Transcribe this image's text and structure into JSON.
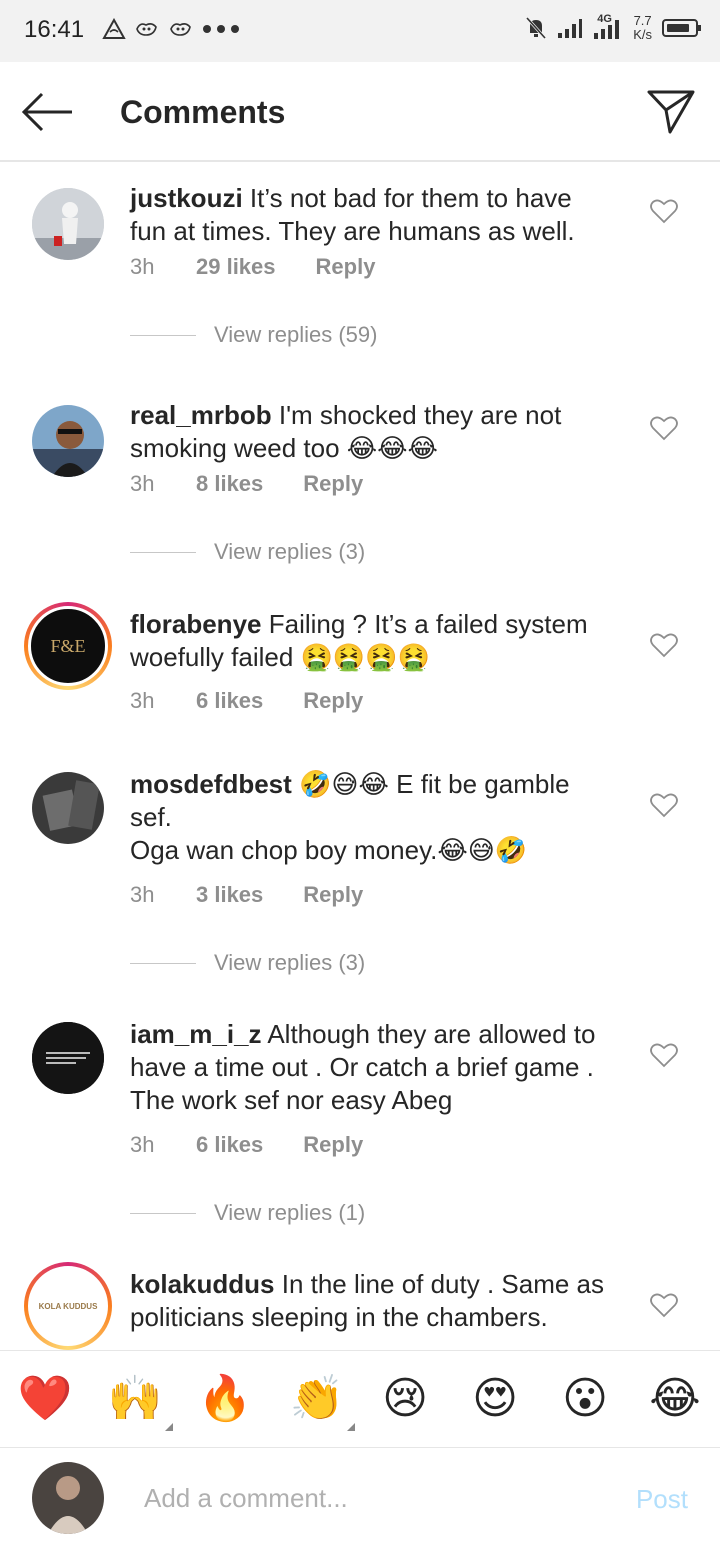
{
  "status_bar": {
    "time": "16:41",
    "network": "4G",
    "speed_top": "7.7",
    "speed_bottom": "K/s",
    "icons": [
      "alert-triangle-icon",
      "notification-icon",
      "notification-icon",
      "more-dots-icon",
      "mute-bell-icon",
      "signal-icon",
      "signal-4g-icon",
      "battery-icon"
    ]
  },
  "header": {
    "title": "Comments"
  },
  "comments": [
    {
      "username": "justkouzi",
      "lines": [
        "It’s not bad for them to have",
        "fun at times. They are humans as well."
      ],
      "time": "3h",
      "likes": "29 likes",
      "reply": "Reply",
      "view_replies": "View replies (59)"
    },
    {
      "username": "real_mrbob",
      "lines": [
        "I'm shocked they are not",
        "smoking weed too 😂😂😂"
      ],
      "time": "3h",
      "likes": "8 likes",
      "reply": "Reply",
      "view_replies": "View replies (3)"
    },
    {
      "username": "florabenye",
      "lines": [
        "Failing ? It’s a failed system",
        "woefully failed 🤮🤮🤮🤮"
      ],
      "time": "3h",
      "likes": "6 likes",
      "reply": "Reply",
      "view_replies": ""
    },
    {
      "username": "mosdefdbest",
      "lines": [
        "🤣😅😂 E fit be gamble",
        "sef.",
        "Oga wan chop boy money.😂😅🤣"
      ],
      "time": "3h",
      "likes": "3 likes",
      "reply": "Reply",
      "view_replies": "View replies (3)"
    },
    {
      "username": "iam_m_i_z",
      "lines": [
        "Although they are allowed to",
        "have a time out . Or catch a brief game .",
        "The work sef nor easy Abeg"
      ],
      "time": "3h",
      "likes": "6 likes",
      "reply": "Reply",
      "view_replies": "View replies (1)"
    },
    {
      "username": "kolakuddus",
      "lines": [
        "In the line of duty . Same as",
        "politicians sleeping in the chambers."
      ],
      "time": "",
      "likes": "",
      "reply": "",
      "view_replies": ""
    }
  ],
  "avatar_texts": {
    "florabenye": "F&E",
    "kolakuddus": "KOLA KUDDUS"
  },
  "reactions": [
    "❤️",
    "🙌",
    "🔥",
    "👏",
    "😢",
    "😍",
    "😮",
    "😂"
  ],
  "composer": {
    "placeholder": "Add a comment...",
    "post_label": "Post"
  }
}
